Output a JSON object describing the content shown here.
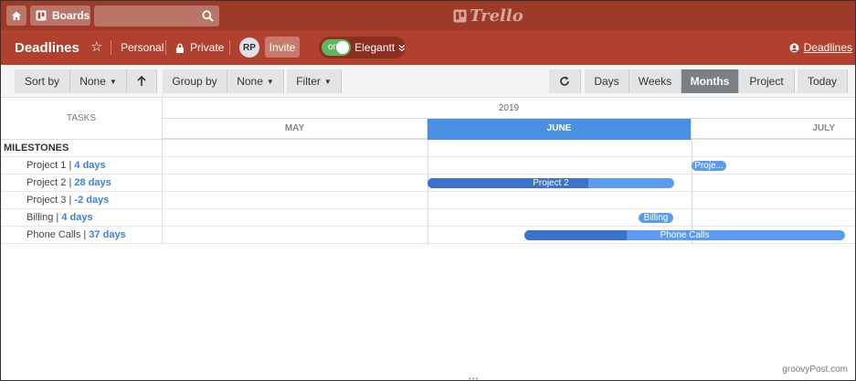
{
  "topbar": {
    "boards_label": "Boards",
    "logo": "Trello"
  },
  "board": {
    "title": "Deadlines",
    "visibility_team": "Personal",
    "visibility": "Private",
    "avatar_initials": "RP",
    "invite_label": "Invite",
    "toggle_label": "on",
    "plugin_label": "Elegantt",
    "board_link": "Deadlines"
  },
  "toolbar": {
    "sort_label": "Sort by",
    "sort_value": "None",
    "group_label": "Group by",
    "group_value": "None",
    "filter_label": "Filter",
    "views": [
      "Days",
      "Weeks",
      "Months",
      "Project",
      "Today"
    ],
    "active_view": "Months"
  },
  "gantt": {
    "tasks_header": "TASKS",
    "year": "2019",
    "months": [
      "MAY",
      "JUNE",
      "JULY"
    ],
    "current_month": "JUNE",
    "group": "MILESTONES",
    "rows": [
      {
        "name": "Project 1",
        "duration": "4 days",
        "bar_label": "Proje..."
      },
      {
        "name": "Project 2",
        "duration": "28 days",
        "bar_label": "Project 2"
      },
      {
        "name": "Project 3",
        "duration": "-2 days",
        "bar_label": ""
      },
      {
        "name": "Billing",
        "duration": "4 days",
        "bar_label": "Billing"
      },
      {
        "name": "Phone Calls",
        "duration": "37 days",
        "bar_label": "Phone Calls"
      }
    ]
  },
  "footer": {
    "watermark": "groovyPost.com",
    "handle": "•••"
  },
  "colors": {
    "header": "#9e3a28",
    "boardbar": "#b0412e",
    "accent": "#4a90e2",
    "bar": "#5b9cf0"
  }
}
